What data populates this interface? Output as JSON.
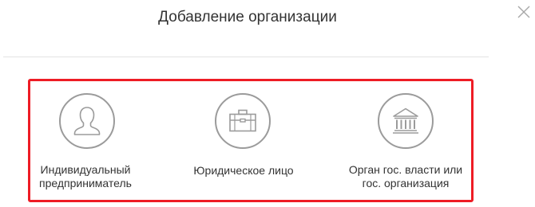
{
  "dialog": {
    "title": "Добавление организации",
    "close_icon": "close-x-icon"
  },
  "options": [
    {
      "id": "individual",
      "icon": "person-icon",
      "label_lines": [
        "Индивидуальный",
        "предприниматель"
      ]
    },
    {
      "id": "legal-entity",
      "icon": "briefcase-icon",
      "label_lines": [
        "Юридическое лицо"
      ]
    },
    {
      "id": "government",
      "icon": "government-building-icon",
      "label_lines": [
        "Орган гос. власти или",
        "гос. организация"
      ]
    }
  ],
  "colors": {
    "highlight_border": "#ee1c25",
    "icon_stroke": "#9b9b9b",
    "text": "#333333",
    "divider": "#e3e3e3"
  }
}
